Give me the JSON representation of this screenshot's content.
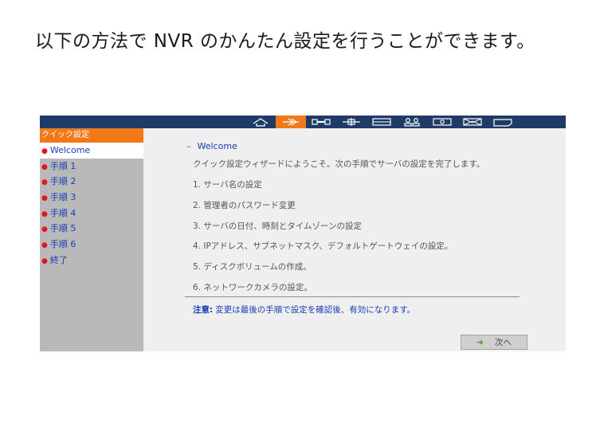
{
  "slide": {
    "title": "以下の方法で NVR のかんたん設定を行うことができます。"
  },
  "toolbar": {
    "icons": [
      {
        "name": "home-icon",
        "active": false
      },
      {
        "name": "quick-setup-icon",
        "active": true
      },
      {
        "name": "settings-icon",
        "active": false
      },
      {
        "name": "network-icon",
        "active": false
      },
      {
        "name": "storage-icon",
        "active": false
      },
      {
        "name": "users-icon",
        "active": false
      },
      {
        "name": "camera-icon",
        "active": false
      },
      {
        "name": "mail-icon",
        "active": false
      },
      {
        "name": "log-icon",
        "active": false
      }
    ]
  },
  "sidebar": {
    "header": "クイック設定",
    "items": [
      {
        "label": "Welcome",
        "active": true
      },
      {
        "label": "手順 1",
        "active": false
      },
      {
        "label": "手順 2",
        "active": false
      },
      {
        "label": "手順 3",
        "active": false
      },
      {
        "label": "手順 4",
        "active": false
      },
      {
        "label": "手順 5",
        "active": false
      },
      {
        "label": "手順 6",
        "active": false
      },
      {
        "label": "終了",
        "active": false
      }
    ]
  },
  "main": {
    "dash": "–",
    "title": "Welcome",
    "intro": "クイック設定ウィザードにようこそ。次の手順でサーバの設定を完了します。",
    "steps": [
      "1. サーバ名の設定",
      "2. 管理者のパスワード変更",
      "3. サーバの日付、時刻とタイムゾーンの設定",
      "4. IPアドレス、サブネットマスク、デフォルトゲートウェイの設定。",
      "5. ディスクボリュームの作成。",
      "6. ネットワークカメラの設定。"
    ],
    "note_label": "注意:",
    "note_text": "変更は最後の手順で設定を確認後、有効になります。",
    "next_arrow": "➔",
    "next_label": "次へ"
  },
  "colors": {
    "topbar": "#1f3c68",
    "accent": "#f07a1a",
    "link": "#1a3db8",
    "bullet": "#e01818",
    "sidebar_bg": "#b9b9b9",
    "content_bg": "#efefef"
  }
}
